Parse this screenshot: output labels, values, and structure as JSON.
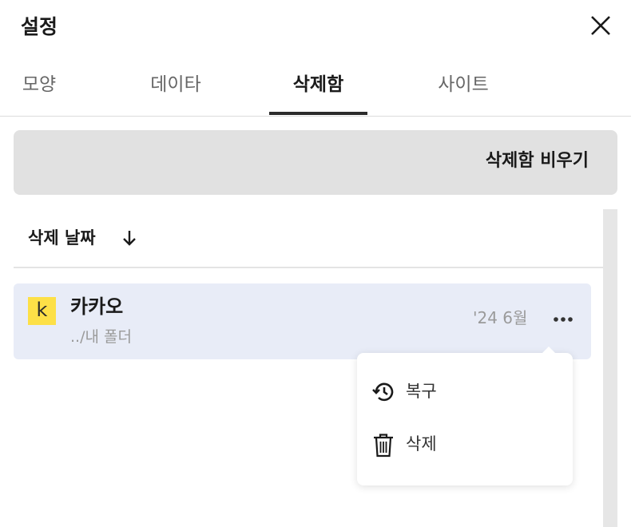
{
  "header": {
    "title": "설정",
    "close_icon": "close-icon"
  },
  "tabs": [
    {
      "label": "모양",
      "active": false
    },
    {
      "label": "데이타",
      "active": false
    },
    {
      "label": "삭제함",
      "active": true
    },
    {
      "label": "사이트",
      "active": false
    }
  ],
  "trash": {
    "empty_button_label": "삭제함 비우기",
    "sort_label": "삭제 날짜",
    "sort_icon": "arrow-down-icon"
  },
  "items": [
    {
      "logo_letter": "k",
      "logo_color": "#fde047",
      "name": "카카오",
      "path": "../내 폴더",
      "date": "'24 6월",
      "more_icon": "more-horizontal-icon"
    }
  ],
  "context_menu": {
    "items": [
      {
        "label": "복구",
        "icon": "restore-history-icon"
      },
      {
        "label": "삭제",
        "icon": "trash-icon"
      }
    ]
  },
  "colors": {
    "selected_row_bg": "#e8ecf7",
    "toolbar_bg": "#e1e1e1",
    "accent": "#2b2b2b"
  }
}
